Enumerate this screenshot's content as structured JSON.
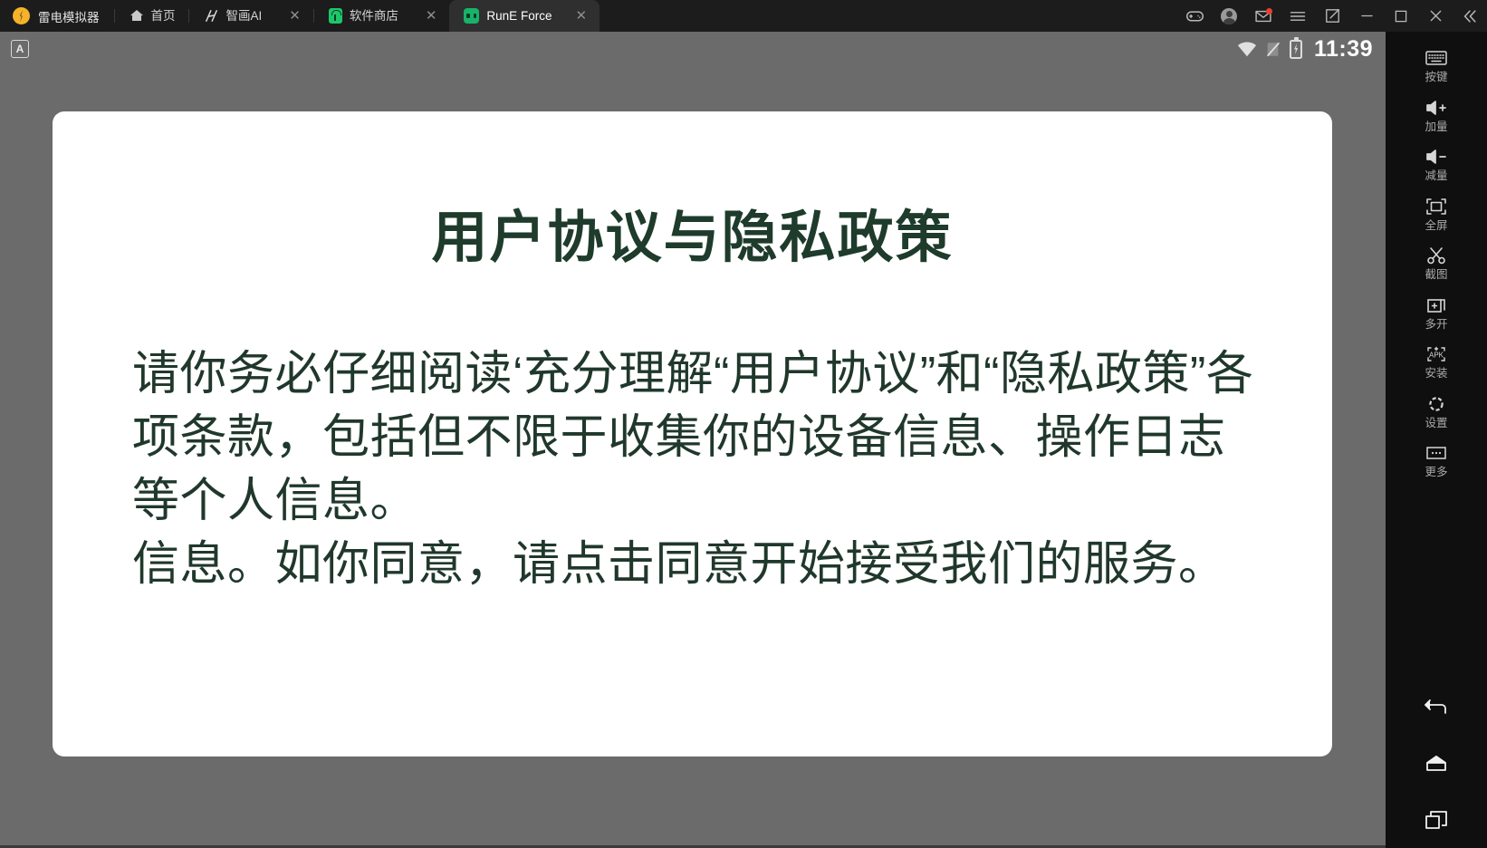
{
  "titlebar": {
    "brand": "雷电模拟器",
    "brand_icon": "lightning-logo-icon",
    "tabs": [
      {
        "label": "首页",
        "icon": "home-icon",
        "closable": false,
        "active": false
      },
      {
        "label": "智画AI",
        "icon": "wave-icon",
        "closable": true,
        "close_glyph": "✕",
        "active": false
      },
      {
        "label": "软件商店",
        "icon": "app-store-icon",
        "closable": true,
        "close_glyph": "✕",
        "active": false
      },
      {
        "label": "RunE Force",
        "icon": "rune-force-icon",
        "closable": true,
        "close_glyph": "✕",
        "active": true
      }
    ],
    "actions": [
      {
        "name": "gamepad-icon"
      },
      {
        "name": "user-avatar-icon"
      },
      {
        "name": "mail-icon",
        "badge": true
      },
      {
        "name": "hamburger-menu-icon"
      },
      {
        "name": "resize-icon"
      },
      {
        "name": "minimize-icon"
      },
      {
        "name": "maximize-icon"
      },
      {
        "name": "close-icon"
      },
      {
        "name": "collapse-chevrons-icon"
      }
    ]
  },
  "statusbar": {
    "app_badge": "A",
    "wifi_icon": "wifi-icon",
    "signal_icon": "no-signal-icon",
    "battery_icon": "battery-charging-icon",
    "time": "11:39"
  },
  "card": {
    "title": "用户协议与隐私政策",
    "paragraphs": [
      "请你务必仔细阅读‘充分理解“用户协议”和“隐私政策”各项条款，包括但不限于收集你的设备信息、操作日志等个人信息。",
      "信息。如你同意，请点击同意开始接受我们的服务。"
    ]
  },
  "sidebar": {
    "items": [
      {
        "label": "按键",
        "icon": "keyboard-icon"
      },
      {
        "label": "加量",
        "icon": "volume-up-icon"
      },
      {
        "label": "减量",
        "icon": "volume-down-icon"
      },
      {
        "label": "全屏",
        "icon": "fullscreen-icon"
      },
      {
        "label": "截图",
        "icon": "scissors-screenshot-icon"
      },
      {
        "label": "多开",
        "icon": "multi-instance-icon"
      },
      {
        "label": "安装",
        "icon": "apk-install-icon"
      },
      {
        "label": "设置",
        "icon": "settings-gear-icon"
      },
      {
        "label": "更多",
        "icon": "more-dots-icon"
      }
    ],
    "nav": [
      {
        "name": "back-icon"
      },
      {
        "name": "home-nav-icon"
      },
      {
        "name": "recent-apps-icon"
      }
    ]
  },
  "colors": {
    "titlebar_bg": "#1c1c1c",
    "active_tab_bg": "#2f2f2f",
    "screen_bg": "#6b6b6b",
    "card_bg": "#ffffff",
    "text_green": "#20382c",
    "sidebar_bg": "#0f0f0f",
    "brand_yellow": "#f5b32a",
    "badge_red": "#e8412f"
  }
}
